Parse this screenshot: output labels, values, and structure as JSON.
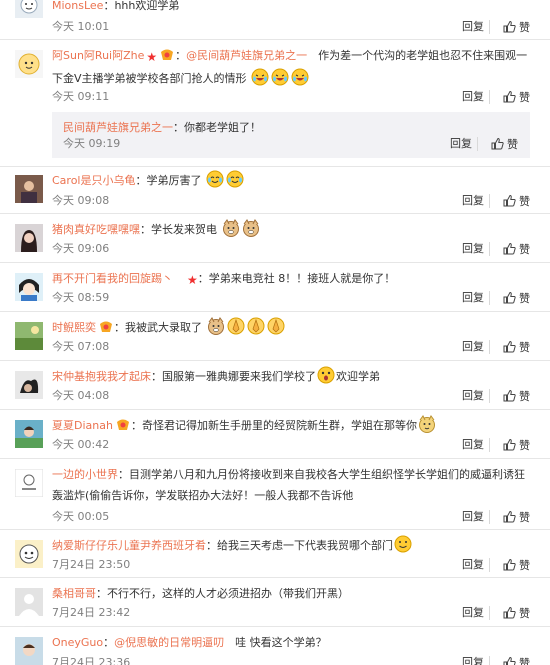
{
  "ui": {
    "reply_label": "回复",
    "like_label": "赞"
  },
  "comments": [
    {
      "user": "MionsLee",
      "text": "：hhh欢迎学弟",
      "time": "今天 10:01",
      "avatar": "avatar-face-icon"
    },
    {
      "user": "阿Sun阿Rui阿Zhe",
      "mention": "@民间葫芦娃旗兄弟之一",
      "text": "作为差一个代沟的老学姐也忍不住来围观一下金V主播学弟被学校各部门抢人的情形",
      "time": "今天 09:11",
      "avatar": "avatar-baby-icon",
      "sub": {
        "user": "民间葫芦娃旗兄弟之一",
        "text": "：你都老学姐了！",
        "time": "今天 09:19"
      }
    },
    {
      "user": "Carol是只小乌龟",
      "text": "：学弟厉害了",
      "time": "今天 09:08",
      "avatar": "avatar-photo-icon"
    },
    {
      "user": "猪肉真好吃嘿嘿嘿",
      "text": "：学长发来贺电",
      "time": "今天 09:06",
      "avatar": "avatar-girl-icon"
    },
    {
      "user": "再不开门看我的回旋踢丶",
      "text": "：学弟来电竞社 8！！接班人就是你了！",
      "time": "今天 08:59",
      "avatar": "avatar-cartoon-icon"
    },
    {
      "user": "时鲵熙奕",
      "text": "：我被武大录取了",
      "time": "今天 07:08",
      "avatar": "avatar-scene-icon"
    },
    {
      "user": "宋仲基抱我我才起床",
      "text": "：国服第一雅典娜要来我们学校了",
      "text2": "欢迎学弟",
      "time": "今天 04:08",
      "avatar": "avatar-dark-icon"
    },
    {
      "user": "夏夏Dianah",
      "text": "：奇怪君记得加新生手册里的经贸院新生群，学姐在那等你",
      "time": "今天 00:42",
      "avatar": "avatar-portrait-icon"
    },
    {
      "user": "一边的小世界",
      "text": "：目测学弟八月和九月份将接收到来自我校各大学生组织怪学长学姐们的威逼利诱狂轰滥炸(偷偷告诉你，学发联招办大法好！一般人我都不告诉他",
      "time": "今天 00:05",
      "avatar": "avatar-logo-icon"
    },
    {
      "user": "纳爱斯仔仔乐儿童尹养西班牙肴",
      "text": "：给我三天考虑一下代表我贸哪个部门",
      "time": "7月24日 23:50",
      "avatar": "avatar-comic-icon"
    },
    {
      "user": "桑相哥哥",
      "text": "：不行不行，这样的人才必须进招办（带我们开黑）",
      "time": "7月24日 23:42",
      "avatar": "avatar-default-icon"
    },
    {
      "user": "OneyGuo",
      "mention": "@倪思敏的日常明逼叨",
      "text": "哇 快看这个学弟？",
      "time": "7月24日 23:36",
      "avatar": "avatar-kid-icon"
    }
  ],
  "colors": {
    "name": "#eb7350",
    "text": "#333333",
    "time": "#808080",
    "divider": "#e6e6e6",
    "sub_bg": "#f2f2f5"
  }
}
